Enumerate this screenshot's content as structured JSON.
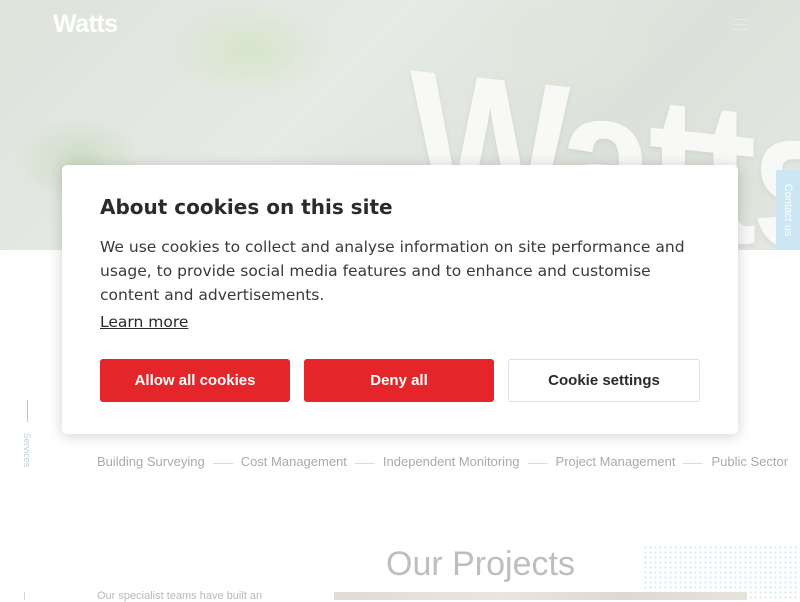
{
  "header": {
    "logo": "Watts",
    "hero_sign": "Watts"
  },
  "side_tab": {
    "contact_label": "Contact us"
  },
  "services": {
    "side_label": "Services",
    "items": [
      "Building Surveying",
      "Cost Management",
      "Independent Monitoring",
      "Project Management",
      "Public Sector"
    ]
  },
  "projects": {
    "title": "Our Projects",
    "intro": "Our specialist teams have built an"
  },
  "cookie_dialog": {
    "title": "About cookies on this site",
    "body": "We use cookies to collect and analyse information on site performance and usage, to provide social media features and to enhance and customise content and advertisements.",
    "learn_more": "Learn more",
    "allow_all": "Allow all cookies",
    "deny_all": "Deny all",
    "settings": "Cookie settings"
  },
  "colors": {
    "accent_red": "#e42529",
    "contact_tab": "#c5e3f3",
    "service_line": "#bfe0f2"
  },
  "icons": [
    "menu-icon"
  ]
}
